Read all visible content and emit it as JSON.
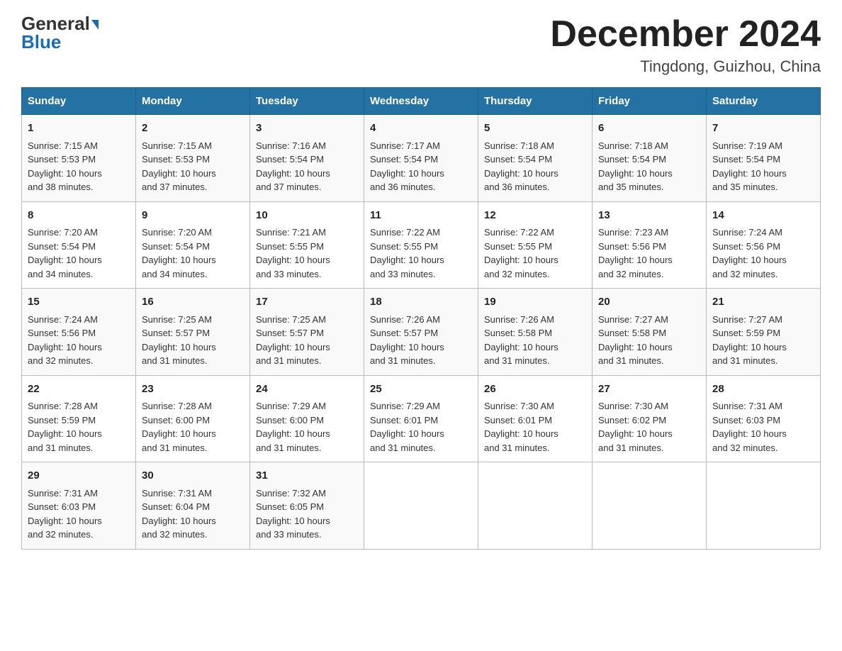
{
  "header": {
    "logo_general": "General",
    "logo_blue": "Blue",
    "month_title": "December 2024",
    "location": "Tingdong, Guizhou, China"
  },
  "days_of_week": [
    "Sunday",
    "Monday",
    "Tuesday",
    "Wednesday",
    "Thursday",
    "Friday",
    "Saturday"
  ],
  "weeks": [
    [
      {
        "day": "1",
        "sunrise": "7:15 AM",
        "sunset": "5:53 PM",
        "daylight": "10 hours and 38 minutes."
      },
      {
        "day": "2",
        "sunrise": "7:15 AM",
        "sunset": "5:53 PM",
        "daylight": "10 hours and 37 minutes."
      },
      {
        "day": "3",
        "sunrise": "7:16 AM",
        "sunset": "5:54 PM",
        "daylight": "10 hours and 37 minutes."
      },
      {
        "day": "4",
        "sunrise": "7:17 AM",
        "sunset": "5:54 PM",
        "daylight": "10 hours and 36 minutes."
      },
      {
        "day": "5",
        "sunrise": "7:18 AM",
        "sunset": "5:54 PM",
        "daylight": "10 hours and 36 minutes."
      },
      {
        "day": "6",
        "sunrise": "7:18 AM",
        "sunset": "5:54 PM",
        "daylight": "10 hours and 35 minutes."
      },
      {
        "day": "7",
        "sunrise": "7:19 AM",
        "sunset": "5:54 PM",
        "daylight": "10 hours and 35 minutes."
      }
    ],
    [
      {
        "day": "8",
        "sunrise": "7:20 AM",
        "sunset": "5:54 PM",
        "daylight": "10 hours and 34 minutes."
      },
      {
        "day": "9",
        "sunrise": "7:20 AM",
        "sunset": "5:54 PM",
        "daylight": "10 hours and 34 minutes."
      },
      {
        "day": "10",
        "sunrise": "7:21 AM",
        "sunset": "5:55 PM",
        "daylight": "10 hours and 33 minutes."
      },
      {
        "day": "11",
        "sunrise": "7:22 AM",
        "sunset": "5:55 PM",
        "daylight": "10 hours and 33 minutes."
      },
      {
        "day": "12",
        "sunrise": "7:22 AM",
        "sunset": "5:55 PM",
        "daylight": "10 hours and 32 minutes."
      },
      {
        "day": "13",
        "sunrise": "7:23 AM",
        "sunset": "5:56 PM",
        "daylight": "10 hours and 32 minutes."
      },
      {
        "day": "14",
        "sunrise": "7:24 AM",
        "sunset": "5:56 PM",
        "daylight": "10 hours and 32 minutes."
      }
    ],
    [
      {
        "day": "15",
        "sunrise": "7:24 AM",
        "sunset": "5:56 PM",
        "daylight": "10 hours and 32 minutes."
      },
      {
        "day": "16",
        "sunrise": "7:25 AM",
        "sunset": "5:57 PM",
        "daylight": "10 hours and 31 minutes."
      },
      {
        "day": "17",
        "sunrise": "7:25 AM",
        "sunset": "5:57 PM",
        "daylight": "10 hours and 31 minutes."
      },
      {
        "day": "18",
        "sunrise": "7:26 AM",
        "sunset": "5:57 PM",
        "daylight": "10 hours and 31 minutes."
      },
      {
        "day": "19",
        "sunrise": "7:26 AM",
        "sunset": "5:58 PM",
        "daylight": "10 hours and 31 minutes."
      },
      {
        "day": "20",
        "sunrise": "7:27 AM",
        "sunset": "5:58 PM",
        "daylight": "10 hours and 31 minutes."
      },
      {
        "day": "21",
        "sunrise": "7:27 AM",
        "sunset": "5:59 PM",
        "daylight": "10 hours and 31 minutes."
      }
    ],
    [
      {
        "day": "22",
        "sunrise": "7:28 AM",
        "sunset": "5:59 PM",
        "daylight": "10 hours and 31 minutes."
      },
      {
        "day": "23",
        "sunrise": "7:28 AM",
        "sunset": "6:00 PM",
        "daylight": "10 hours and 31 minutes."
      },
      {
        "day": "24",
        "sunrise": "7:29 AM",
        "sunset": "6:00 PM",
        "daylight": "10 hours and 31 minutes."
      },
      {
        "day": "25",
        "sunrise": "7:29 AM",
        "sunset": "6:01 PM",
        "daylight": "10 hours and 31 minutes."
      },
      {
        "day": "26",
        "sunrise": "7:30 AM",
        "sunset": "6:01 PM",
        "daylight": "10 hours and 31 minutes."
      },
      {
        "day": "27",
        "sunrise": "7:30 AM",
        "sunset": "6:02 PM",
        "daylight": "10 hours and 31 minutes."
      },
      {
        "day": "28",
        "sunrise": "7:31 AM",
        "sunset": "6:03 PM",
        "daylight": "10 hours and 32 minutes."
      }
    ],
    [
      {
        "day": "29",
        "sunrise": "7:31 AM",
        "sunset": "6:03 PM",
        "daylight": "10 hours and 32 minutes."
      },
      {
        "day": "30",
        "sunrise": "7:31 AM",
        "sunset": "6:04 PM",
        "daylight": "10 hours and 32 minutes."
      },
      {
        "day": "31",
        "sunrise": "7:32 AM",
        "sunset": "6:05 PM",
        "daylight": "10 hours and 33 minutes."
      },
      null,
      null,
      null,
      null
    ]
  ],
  "labels": {
    "sunrise": "Sunrise:",
    "sunset": "Sunset:",
    "daylight": "Daylight:"
  }
}
